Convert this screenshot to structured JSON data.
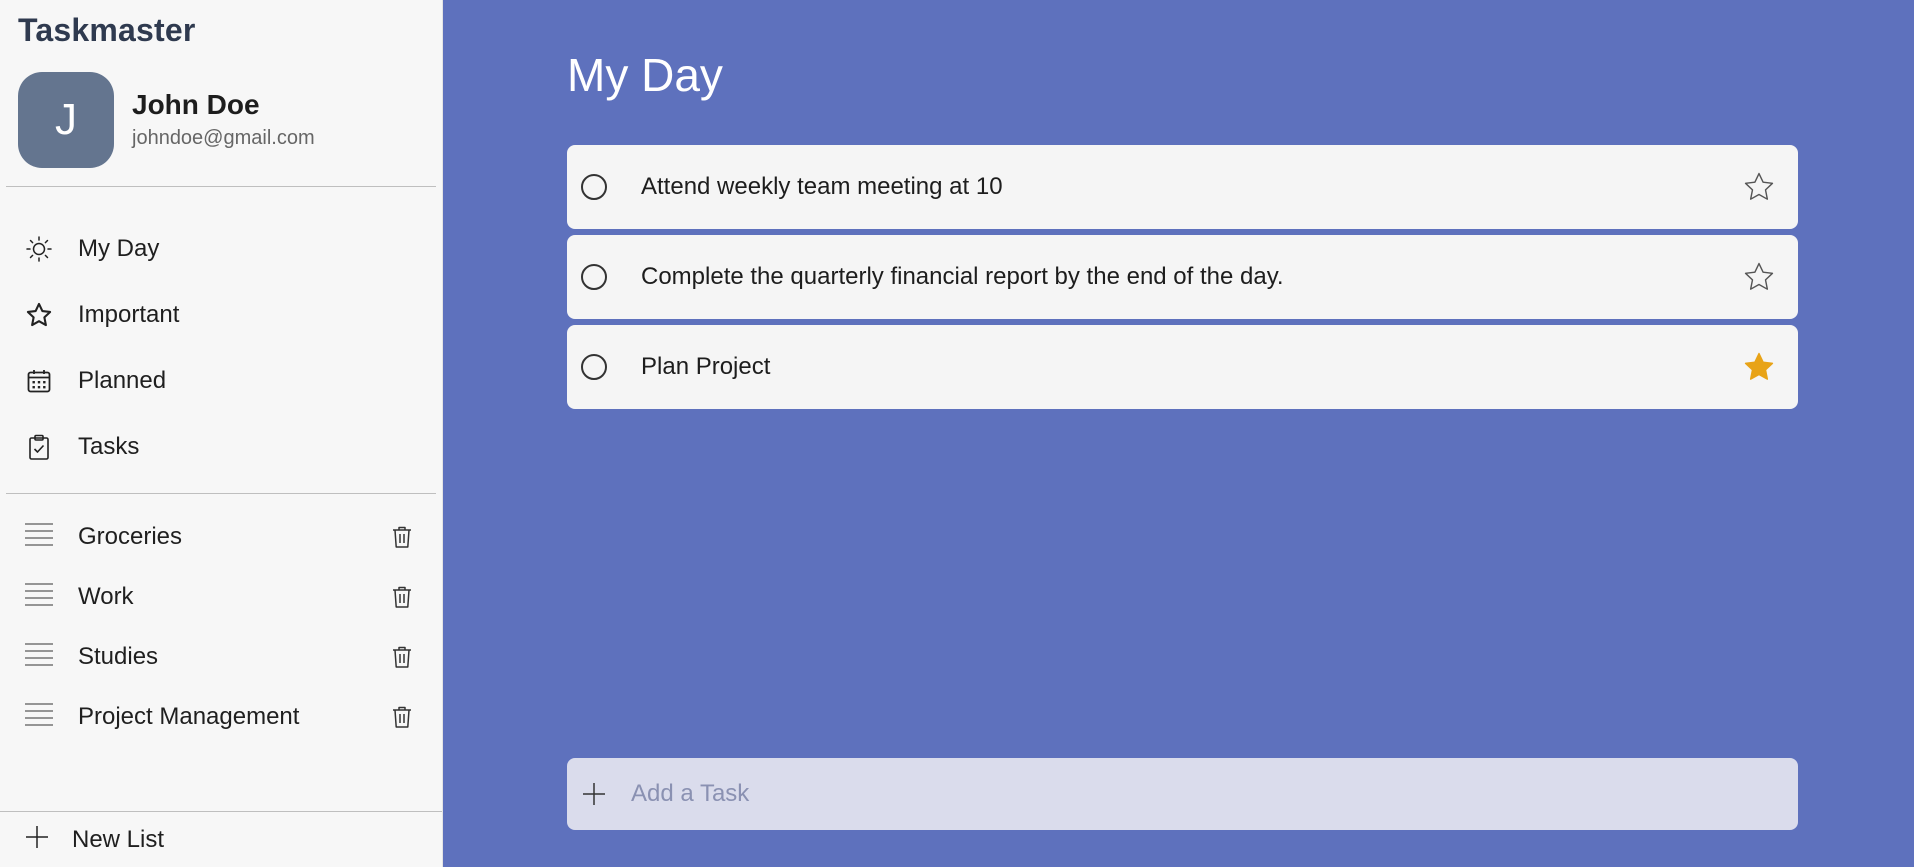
{
  "app": {
    "brand": "Taskmaster"
  },
  "user": {
    "initial": "J",
    "name": "John Doe",
    "email": "johndoe@gmail.com"
  },
  "nav": [
    {
      "label": "My Day",
      "icon": "sun-icon"
    },
    {
      "label": "Important",
      "icon": "star-icon"
    },
    {
      "label": "Planned",
      "icon": "calendar-icon"
    },
    {
      "label": "Tasks",
      "icon": "clipboard-check-icon"
    }
  ],
  "lists": [
    {
      "label": "Groceries"
    },
    {
      "label": "Work"
    },
    {
      "label": "Studies"
    },
    {
      "label": "Project Management"
    }
  ],
  "new_list_label": "New List",
  "main": {
    "title": "My Day",
    "tasks": [
      {
        "text": "Attend weekly team meeting at 10",
        "important": false
      },
      {
        "text": "Complete the quarterly financial report by the end of the day.",
        "important": false
      },
      {
        "text": "Plan Project",
        "important": true
      }
    ],
    "add_task_placeholder": "Add a Task"
  },
  "colors": {
    "main_bg": "#5e71bd",
    "sidebar_bg": "#f7f7f7",
    "avatar_bg": "#64758f",
    "star_active": "#e8a317",
    "add_task_bg": "#dadcec"
  }
}
